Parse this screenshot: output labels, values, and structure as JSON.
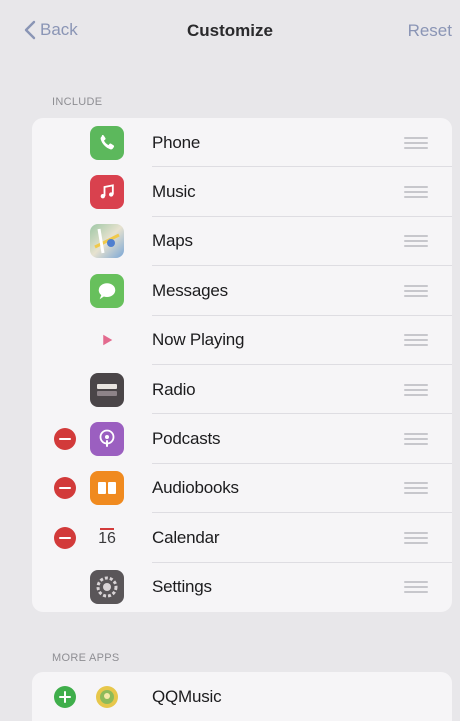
{
  "nav": {
    "back_label": "Back",
    "title": "Customize",
    "reset_label": "Reset"
  },
  "include": {
    "header": "INCLUDE",
    "items": [
      {
        "label": "Phone",
        "icon": "phone-icon",
        "removable": false
      },
      {
        "label": "Music",
        "icon": "music-icon",
        "removable": false
      },
      {
        "label": "Maps",
        "icon": "maps-icon",
        "removable": false
      },
      {
        "label": "Messages",
        "icon": "messages-icon",
        "removable": false
      },
      {
        "label": "Now Playing",
        "icon": "now-playing-icon",
        "removable": false
      },
      {
        "label": "Radio",
        "icon": "radio-icon",
        "removable": false
      },
      {
        "label": "Podcasts",
        "icon": "podcasts-icon",
        "removable": true
      },
      {
        "label": "Audiobooks",
        "icon": "audiobooks-icon",
        "removable": true
      },
      {
        "label": "Calendar",
        "icon": "calendar-icon",
        "removable": true,
        "day": "16"
      },
      {
        "label": "Settings",
        "icon": "settings-icon",
        "removable": false
      }
    ]
  },
  "more_apps": {
    "header": "MORE APPS",
    "items": [
      {
        "label": "QQMusic",
        "icon": "qqmusic-icon"
      }
    ]
  },
  "colors": {
    "accent": "#8a95b5",
    "remove": "#d23a3a",
    "add": "#3fae4b"
  }
}
